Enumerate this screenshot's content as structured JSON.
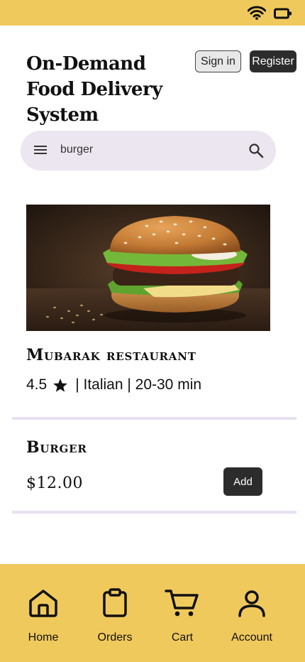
{
  "status_bar": {
    "background": "#f0c95d",
    "icons": [
      "wifi-icon",
      "battery-icon"
    ]
  },
  "header": {
    "title": "On-Demand Food Delivery System",
    "signin_label": "Sign in",
    "register_label": "Register"
  },
  "search": {
    "value": "burger",
    "icons": [
      "menu-icon",
      "search-icon"
    ]
  },
  "restaurant": {
    "image": "burger-photo",
    "name": "Mubarak restaurant",
    "rating": "4.5",
    "rating_icon": "star-icon",
    "details": "| Italian | 20-30 min"
  },
  "menu_item": {
    "name": "Burger",
    "price": "$12.00",
    "add_label": "Add"
  },
  "bottom_nav": {
    "background": "#f0c95d",
    "items": [
      {
        "label": "Home",
        "icon": "home-icon"
      },
      {
        "label": "Orders",
        "icon": "orders-icon"
      },
      {
        "label": "Cart",
        "icon": "cart-icon"
      },
      {
        "label": "Account",
        "icon": "account-icon"
      }
    ]
  }
}
